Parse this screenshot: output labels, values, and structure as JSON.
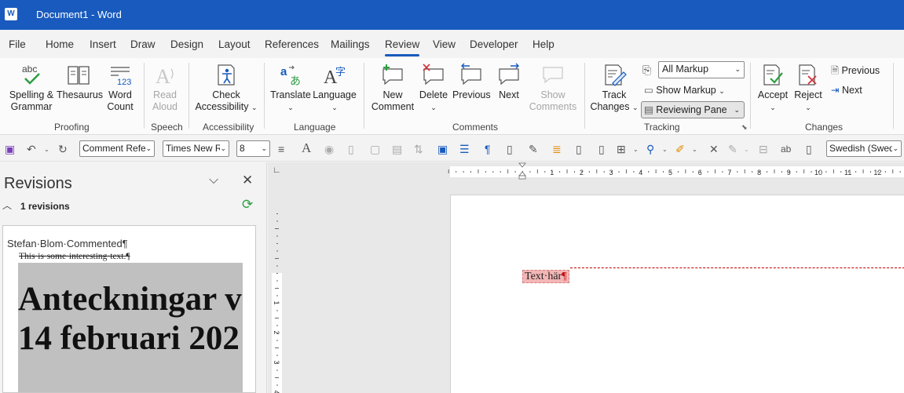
{
  "app": {
    "title": "Document1  -  Word",
    "icon_label": "W"
  },
  "tabs": [
    "File",
    "Home",
    "Insert",
    "Draw",
    "Design",
    "Layout",
    "References",
    "Mailings",
    "Review",
    "View",
    "Developer",
    "Help"
  ],
  "active_tab": "Review",
  "ribbon": {
    "proofing": {
      "spelling": "Spelling &",
      "spelling2": "Grammar",
      "thesaurus": "Thesaurus",
      "wordcount": "Word",
      "wordcount2": "Count",
      "group": "Proofing"
    },
    "speech": {
      "read": "Read",
      "read2": "Aloud",
      "group": "Speech"
    },
    "accessibility": {
      "check": "Check",
      "check2": "Accessibility",
      "group": "Accessibility"
    },
    "language": {
      "translate": "Translate",
      "language": "Language",
      "group": "Language"
    },
    "comments": {
      "new": "New",
      "new2": "Comment",
      "delete": "Delete",
      "previous": "Previous",
      "next": "Next",
      "show": "Show",
      "show2": "Comments",
      "group": "Comments"
    },
    "tracking": {
      "track": "Track",
      "track2": "Changes",
      "markup_value": "All Markup",
      "show_markup": "Show Markup",
      "reviewing_pane": "Reviewing Pane",
      "group": "Tracking"
    },
    "changes": {
      "accept": "Accept",
      "reject": "Reject",
      "previous": "Previous",
      "next": "Next",
      "group": "Changes"
    }
  },
  "qat": {
    "style": "Comment Refe",
    "font": "Times New R",
    "size": "8",
    "lang": "Swedish (Swed"
  },
  "revisions_pane": {
    "title": "Revisions",
    "count": "1 revisions",
    "author_line": "Stefan·Blom·Commented¶",
    "comment_text": "This·is·some·interesting·text.¶",
    "image_line1": "Anteckningar v",
    "image_line2": "14 februari 202"
  },
  "document": {
    "text": "Text·här",
    "pilcrow": "¶"
  },
  "ruler": {
    "h_ticks": [
      "1",
      "2",
      "3",
      "4",
      "5",
      "6",
      "7",
      "8",
      "9",
      "10",
      "11",
      "12"
    ],
    "v_ticks": [
      "1",
      "2",
      "3",
      "4"
    ]
  },
  "colors": {
    "accent": "#185abd",
    "highlight": "#f4b6b6",
    "revision_line": "#c00000"
  }
}
